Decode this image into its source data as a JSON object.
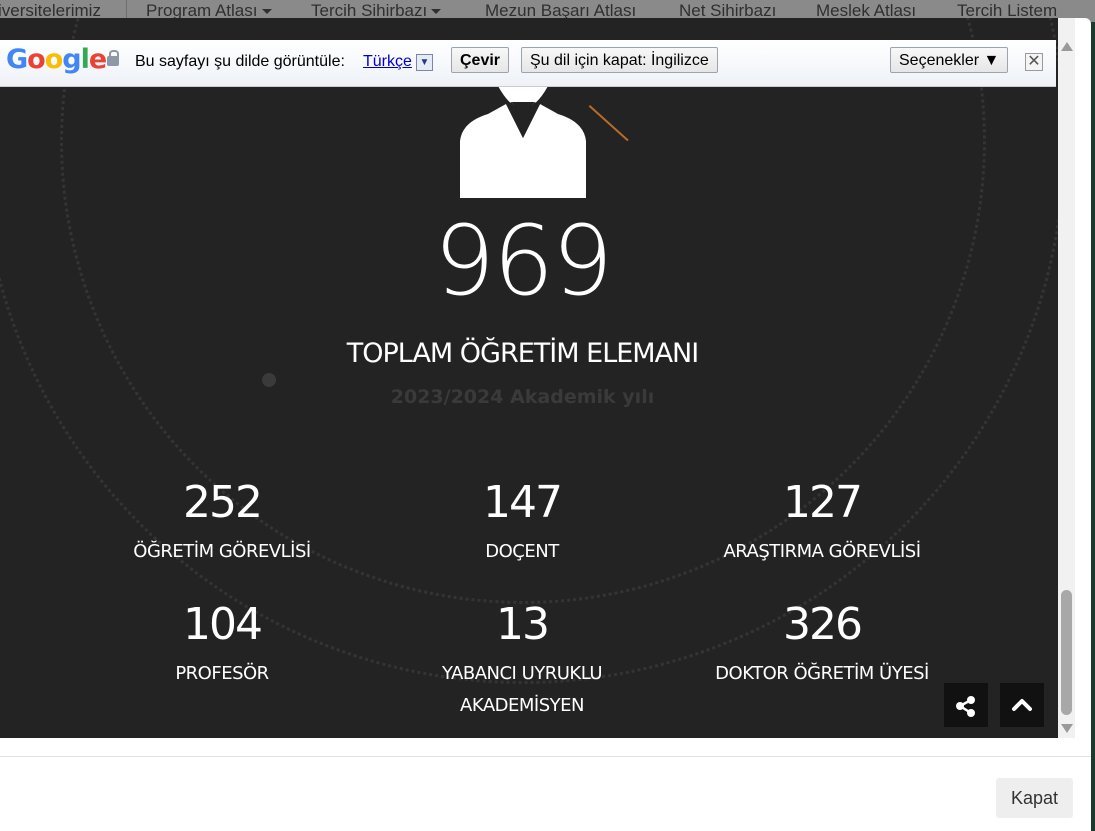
{
  "background_nav": {
    "items": [
      {
        "label": "iversitelerimiz",
        "caret": false
      },
      {
        "label": "Program Atlası",
        "caret": true
      },
      {
        "label": "Tercih Sihirbazı",
        "caret": true
      },
      {
        "label": "Mezun Başarı Atlası",
        "caret": false
      },
      {
        "label": "Net Sihirbazı",
        "caret": false
      },
      {
        "label": "Meslek Atlası",
        "caret": false
      },
      {
        "label": "Tercih Listem",
        "caret": false
      }
    ]
  },
  "translate_bar": {
    "logo": "Google",
    "prompt": "Bu sayfayı şu dilde görüntüle:",
    "language": "Türkçe",
    "translate_button": "Çevir",
    "disable_button": "Şu dil için kapat: İngilizce",
    "options_button": "Seçenekler ▼",
    "close_glyph": "✕"
  },
  "stats_panel": {
    "total_number": "969",
    "total_label": "TOPLAM ÖĞRETİM ELEMANI",
    "year_label": "2023/2024 Akademik yılı",
    "items": [
      {
        "value": "252",
        "label": "ÖĞRETİM GÖREVLİSİ"
      },
      {
        "value": "147",
        "label": "DOÇENT"
      },
      {
        "value": "127",
        "label": "ARAŞTIRMA GÖREVLİSİ"
      },
      {
        "value": "104",
        "label": "PROFESÖR"
      },
      {
        "value": "13",
        "label": "YABANCI UYRUKLU AKADEMİSYEN"
      },
      {
        "value": "326",
        "label": "DOKTOR ÖĞRETİM ÜYESİ"
      }
    ]
  },
  "icons": {
    "avatar": "person-icon",
    "share": "share-icon",
    "scroll_top": "chevron-up-icon"
  },
  "footer": {
    "close_label": "Kapat"
  },
  "colors": {
    "panel_bg": "#232323",
    "accent_line": "#b56c2c"
  }
}
